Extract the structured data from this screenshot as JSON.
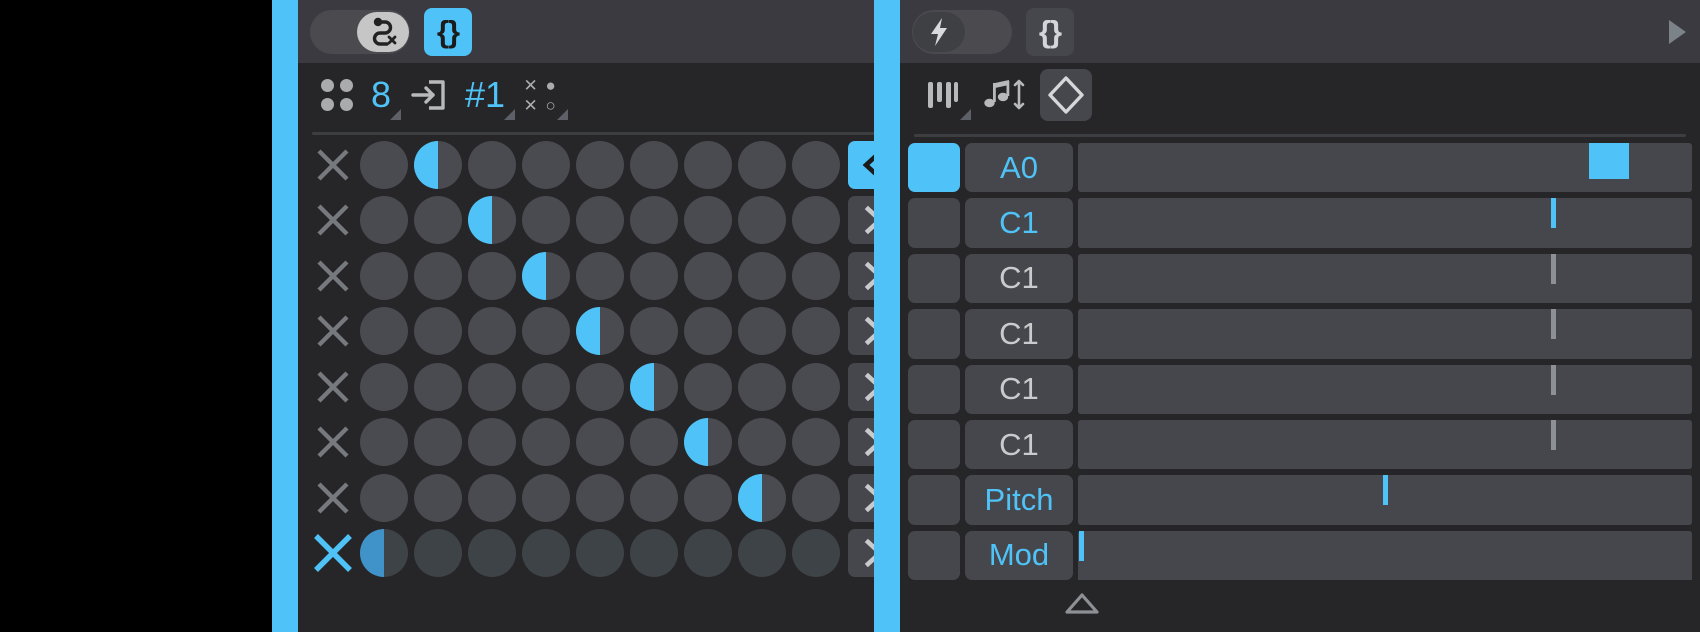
{
  "theme": {
    "accent": "#4fc3f7",
    "panel_bg": "#262628",
    "header_bg": "#3a3a40",
    "button_bg": "#46474c",
    "cell_bg": "#4a4b50",
    "icon_gray": "#a9abad",
    "canvas_bg": "#000000"
  },
  "left_panel": {
    "header": {
      "toggle": {
        "state": "on",
        "knob_icon": "route-cancel-icon"
      },
      "brace_button": {
        "label": "{}",
        "state": "active",
        "icon": "braces-icon"
      },
      "play_icon": "play-triangle-icon"
    },
    "toolbar": [
      {
        "name": "pattern-grid-icon",
        "type": "icon",
        "icon": "four-dots-icon",
        "label": ""
      },
      {
        "name": "step-count",
        "type": "value",
        "icon": "",
        "label": "8",
        "has_corner": true
      },
      {
        "name": "input-route-icon",
        "type": "icon",
        "icon": "arrow-into-box-icon",
        "label": ""
      },
      {
        "name": "pattern-number",
        "type": "value",
        "icon": "",
        "label": "#1",
        "has_corner": true
      },
      {
        "name": "randomize-icon",
        "type": "icon",
        "icon": "x-dot-matrix-icon",
        "label": "",
        "has_corner": true
      }
    ],
    "grid": {
      "columns": 9,
      "rows": [
        {
          "clear_icon": "x-icon",
          "clear_state": "normal",
          "dim": false,
          "fills": [
            0,
            100,
            0,
            0,
            0,
            0,
            0,
            0,
            0
          ],
          "arrow": {
            "glyph": "<",
            "state": "active"
          }
        },
        {
          "clear_icon": "x-icon",
          "clear_state": "normal",
          "dim": false,
          "fills": [
            0,
            0,
            100,
            0,
            0,
            0,
            0,
            0,
            0
          ],
          "arrow": {
            "glyph": ">",
            "state": "idle"
          }
        },
        {
          "clear_icon": "x-icon",
          "clear_state": "normal",
          "dim": false,
          "fills": [
            0,
            0,
            0,
            100,
            0,
            0,
            0,
            0,
            0
          ],
          "arrow": {
            "glyph": ">",
            "state": "idle"
          }
        },
        {
          "clear_icon": "x-icon",
          "clear_state": "normal",
          "dim": false,
          "fills": [
            0,
            0,
            0,
            0,
            100,
            0,
            0,
            0,
            0
          ],
          "arrow": {
            "glyph": ">",
            "state": "idle"
          }
        },
        {
          "clear_icon": "x-icon",
          "clear_state": "normal",
          "dim": false,
          "fills": [
            0,
            0,
            0,
            0,
            0,
            100,
            0,
            0,
            0
          ],
          "arrow": {
            "glyph": ">",
            "state": "idle"
          }
        },
        {
          "clear_icon": "x-icon",
          "clear_state": "normal",
          "dim": false,
          "fills": [
            0,
            0,
            0,
            0,
            0,
            0,
            100,
            0,
            0
          ],
          "arrow": {
            "glyph": ">",
            "state": "idle"
          }
        },
        {
          "clear_icon": "x-icon",
          "clear_state": "normal",
          "dim": false,
          "fills": [
            0,
            0,
            0,
            0,
            0,
            0,
            0,
            100,
            0
          ],
          "arrow": {
            "glyph": ">",
            "state": "idle"
          }
        },
        {
          "clear_icon": "x-icon",
          "clear_state": "highlighted",
          "dim": true,
          "fills": [
            100,
            0,
            0,
            0,
            0,
            0,
            0,
            0,
            0
          ],
          "arrow": {
            "glyph": ">",
            "state": "idle"
          }
        }
      ]
    }
  },
  "right_panel": {
    "header": {
      "toggle": {
        "state": "off",
        "knob_icon": "lightning-bolt-icon"
      },
      "brace_button": {
        "label": "{}",
        "state": "idle",
        "icon": "braces-icon"
      },
      "play_icon": "play-triangle-icon"
    },
    "toolbar": [
      {
        "name": "keyboard-keys-icon",
        "type": "icon",
        "icon": "piano-keys-icon",
        "label": "",
        "has_corner": true
      },
      {
        "name": "note-transpose-icon",
        "type": "icon",
        "icon": "music-note-updown-icon",
        "label": ""
      },
      {
        "name": "range-icon",
        "type": "icon",
        "icon": "diamond-icon",
        "label": "",
        "boxed": true
      }
    ],
    "rows": [
      {
        "pad": "lit",
        "name": "A0",
        "name_color": "accent",
        "slider": {
          "kind": "block",
          "value_pct": 86.5
        }
      },
      {
        "pad": "unlit",
        "name": "C1",
        "name_color": "accent",
        "slider": {
          "kind": "line-accent",
          "value_pct": 77.5
        }
      },
      {
        "pad": "unlit",
        "name": "C1",
        "name_color": "muted",
        "slider": {
          "kind": "line-gray",
          "value_pct": 77.5
        }
      },
      {
        "pad": "unlit",
        "name": "C1",
        "name_color": "muted",
        "slider": {
          "kind": "line-gray",
          "value_pct": 77.5
        }
      },
      {
        "pad": "unlit",
        "name": "C1",
        "name_color": "muted",
        "slider": {
          "kind": "line-gray",
          "value_pct": 77.5
        }
      },
      {
        "pad": "unlit",
        "name": "C1",
        "name_color": "muted",
        "slider": {
          "kind": "line-gray",
          "value_pct": 77.5
        }
      },
      {
        "pad": "unlit",
        "name": "Pitch",
        "name_color": "accent",
        "slider": {
          "kind": "line-accent",
          "value_pct": 50
        }
      },
      {
        "pad": "unlit",
        "name": "Mod",
        "name_color": "accent",
        "slider": {
          "kind": "line-accent",
          "value_pct": 0.6
        }
      }
    ]
  }
}
